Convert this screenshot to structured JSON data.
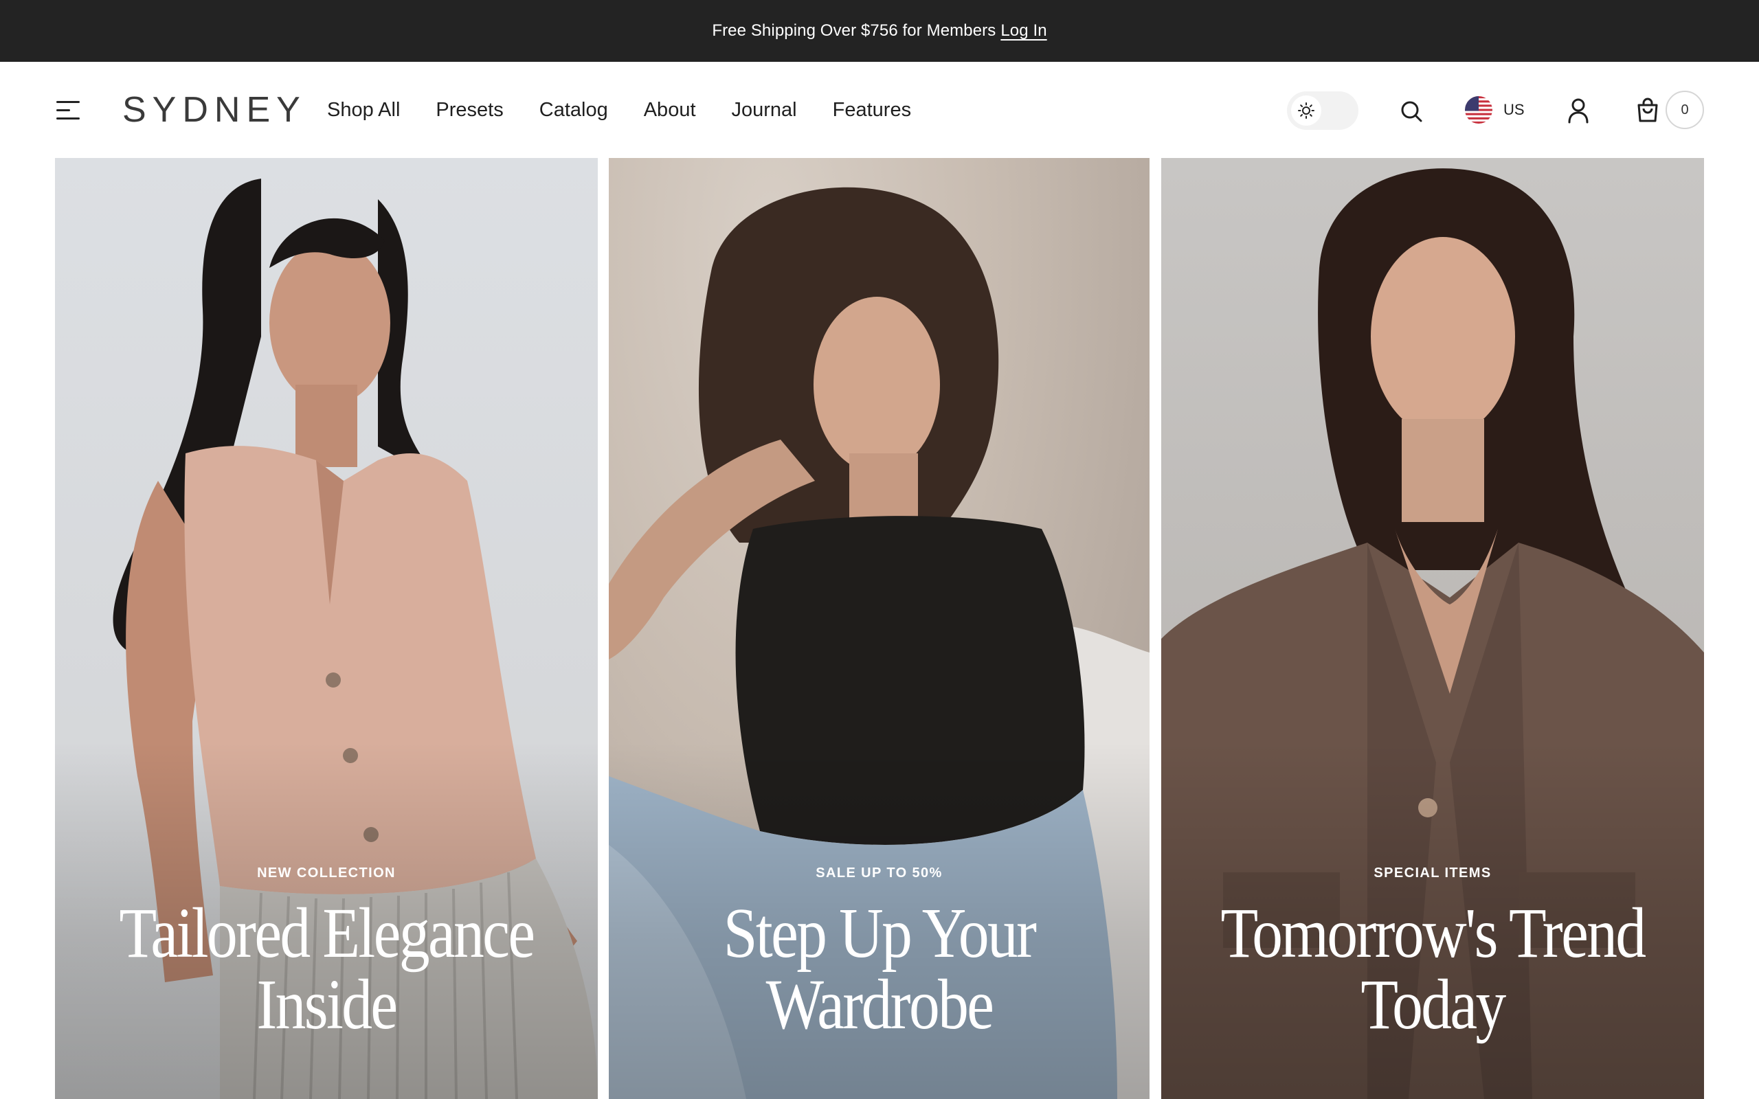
{
  "announcement": {
    "text": "Free Shipping Over $756 for Members",
    "link_label": "Log In"
  },
  "header": {
    "logo": "SYDNEY",
    "nav": [
      "Shop All",
      "Presets",
      "Catalog",
      "About",
      "Journal",
      "Features"
    ],
    "locale_code": "US",
    "cart_count": "0"
  },
  "icons": {
    "menu": "hamburger-menu-icon",
    "theme": "sun-icon",
    "search": "search-icon",
    "flag": "us-flag-icon",
    "account": "user-icon",
    "cart": "shopping-bag-icon"
  },
  "hero": {
    "panels": [
      {
        "eyebrow": "NEW COLLECTION",
        "headline": "Tailored Elegance Inside"
      },
      {
        "eyebrow": "SALE UP TO 50%",
        "headline": "Step Up Your Wardrobe"
      },
      {
        "eyebrow": "SPECIAL ITEMS",
        "headline": "Tomorrow's Trend Today"
      }
    ]
  },
  "colors": {
    "announcement_bg": "#232323",
    "text_dark": "#1f1f1f",
    "caption_text": "#ffffff"
  }
}
